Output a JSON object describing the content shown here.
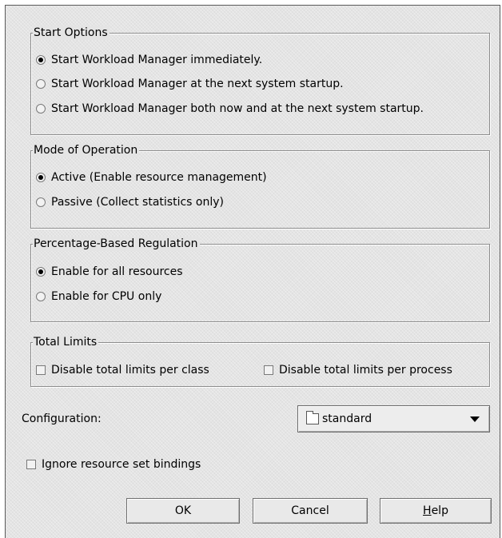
{
  "start_options": {
    "legend": "Start Options",
    "options": [
      {
        "label": "Start Workload Manager immediately.",
        "selected": true
      },
      {
        "label": "Start Workload Manager at the next system startup.",
        "selected": false
      },
      {
        "label": "Start Workload Manager both now and at the next system startup.",
        "selected": false
      }
    ]
  },
  "mode": {
    "legend": "Mode of Operation",
    "options": [
      {
        "label": "Active (Enable resource management)",
        "selected": true
      },
      {
        "label": "Passive (Collect statistics only)",
        "selected": false
      }
    ]
  },
  "regulation": {
    "legend": "Percentage-Based Regulation",
    "options": [
      {
        "label": "Enable for all resources",
        "selected": true
      },
      {
        "label": "Enable for CPU only",
        "selected": false
      }
    ]
  },
  "total_limits": {
    "legend": "Total Limits",
    "per_class": {
      "label": "Disable total limits per class",
      "checked": false
    },
    "per_process": {
      "label": "Disable total limits per process",
      "checked": false
    }
  },
  "configuration": {
    "label": "Configuration:",
    "selected": "standard",
    "icon": "folder-icon"
  },
  "ignore_bindings": {
    "label": "Ignore resource set bindings",
    "checked": false
  },
  "buttons": {
    "ok": "OK",
    "cancel": "Cancel",
    "help_mnemonic": "H",
    "help_rest": "elp"
  }
}
